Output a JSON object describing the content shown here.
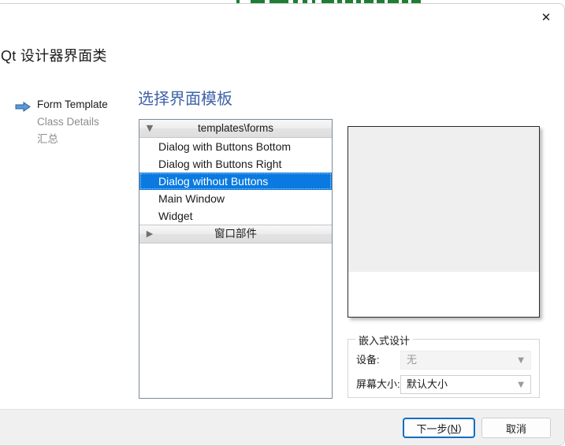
{
  "window": {
    "title": "Qt 设计器界面类",
    "close_icon": "close-icon"
  },
  "nav": {
    "items": [
      {
        "label": "Form Template",
        "active": true,
        "icon": "right-arrow-icon"
      },
      {
        "label": "Class Details",
        "active": false
      },
      {
        "label": "汇总",
        "active": false
      }
    ]
  },
  "main": {
    "heading": "选择界面模板",
    "list": {
      "groups": [
        {
          "header": "templates\\forms",
          "chevron": "chevron-down-icon",
          "expanded": true,
          "items": [
            {
              "label": "Dialog with Buttons Bottom",
              "selected": false
            },
            {
              "label": "Dialog with Buttons Right",
              "selected": false
            },
            {
              "label": "Dialog without Buttons",
              "selected": true
            },
            {
              "label": "Main Window",
              "selected": false
            },
            {
              "label": "Widget",
              "selected": false
            }
          ]
        },
        {
          "header": "窗口部件",
          "chevron": "chevron-right-icon",
          "expanded": false,
          "items": []
        }
      ]
    },
    "preview": {
      "name": "template-preview"
    },
    "embedded": {
      "title": "嵌入式设计",
      "device_label": "设备:",
      "device_value": "无",
      "device_disabled": true,
      "screen_label": "屏幕大小:",
      "screen_value": "默认大小",
      "screen_disabled": false,
      "dropdown_icon": "chevron-down-icon"
    }
  },
  "footer": {
    "next_label_prefix": "下一步(",
    "next_mnemonic": "N",
    "next_label_suffix": ")",
    "cancel_label": "取消"
  },
  "colors": {
    "accent_blue": "#0a7ae0",
    "heading_blue": "#3f63a8",
    "primary_border": "#0d6ec4",
    "footer_bg": "#f0f0f0",
    "backdrop_green": "#1e7e34"
  }
}
